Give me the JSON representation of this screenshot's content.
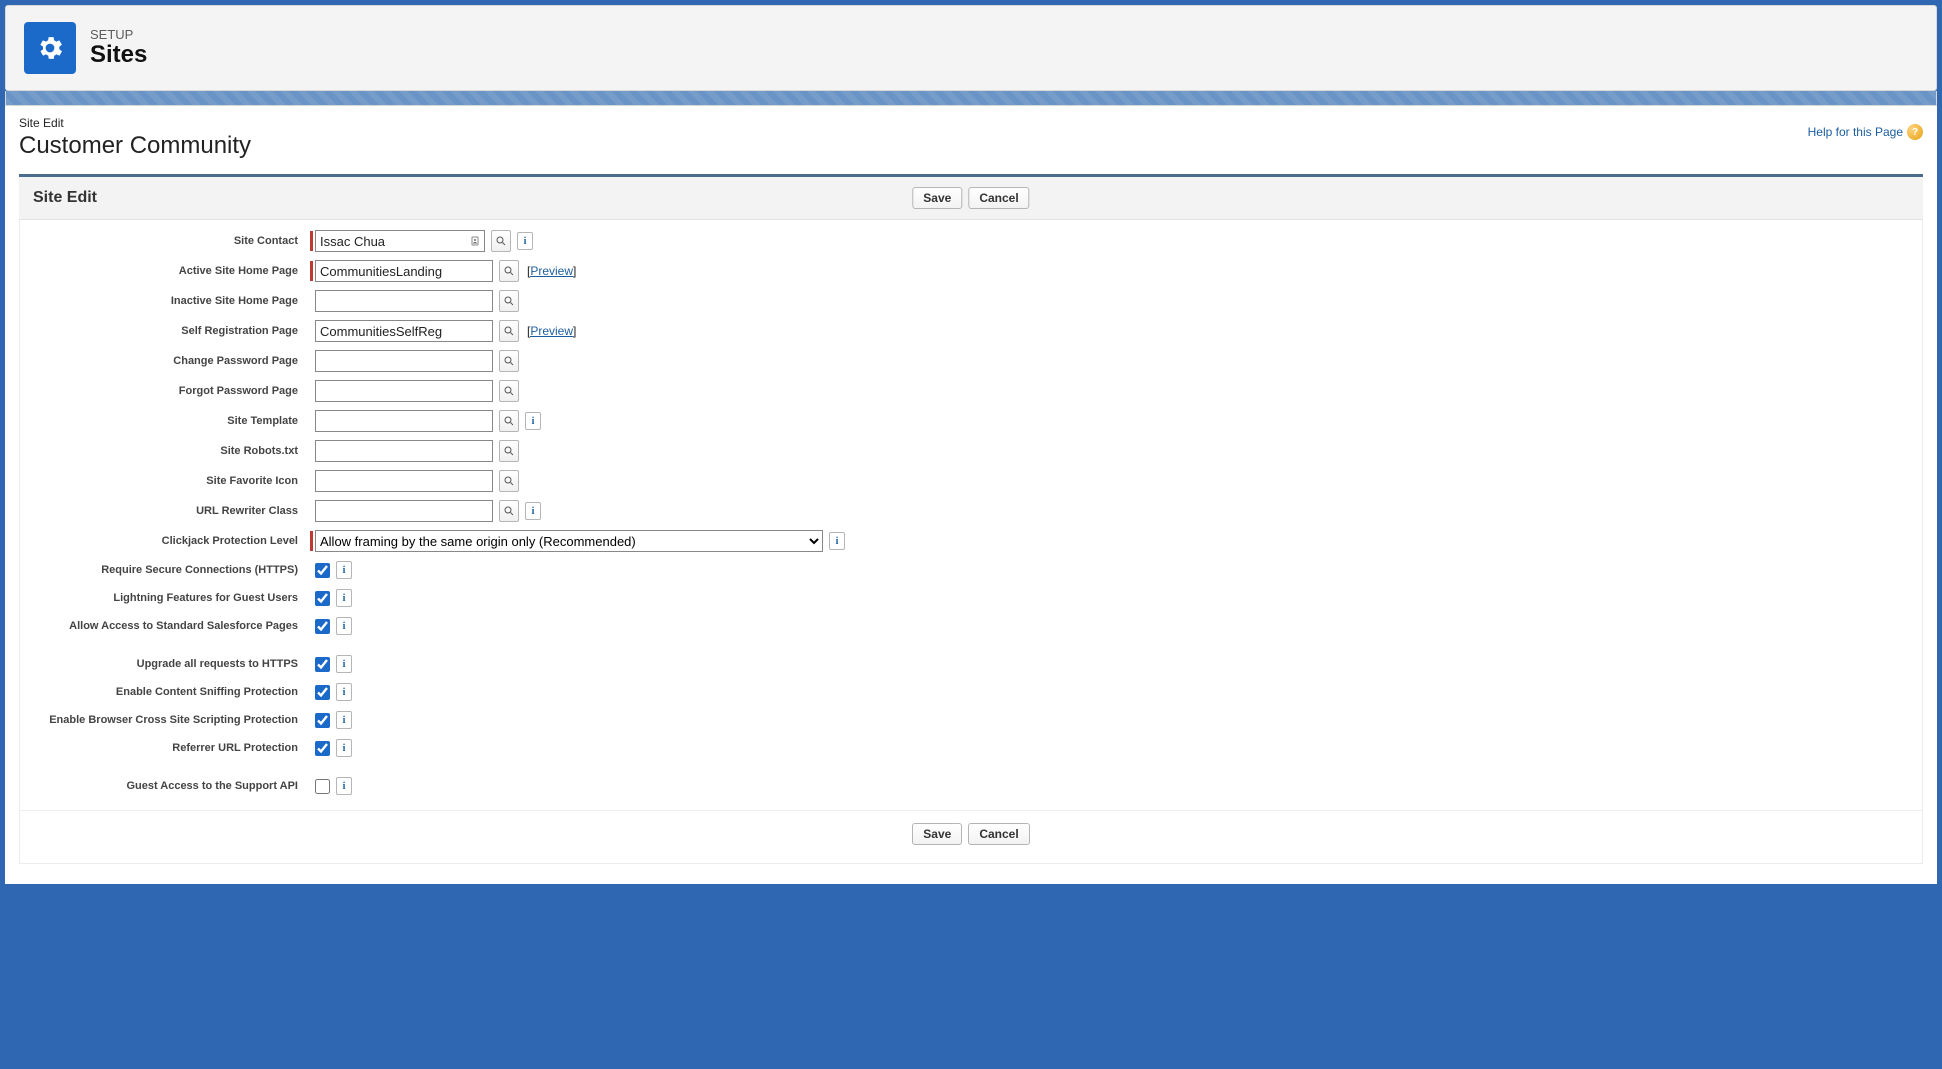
{
  "header": {
    "eyebrow": "SETUP",
    "title": "Sites"
  },
  "page": {
    "crumb": "Site Edit",
    "name": "Customer Community",
    "help_label": "Help for this Page"
  },
  "section": {
    "title": "Site Edit",
    "buttons": {
      "save": "Save",
      "cancel": "Cancel"
    }
  },
  "fields": {
    "site_contact": {
      "label": "Site Contact",
      "value": "Issac Chua",
      "required": true,
      "has_lookup": true,
      "has_info": true
    },
    "active_home_page": {
      "label": "Active Site Home Page",
      "value": "CommunitiesLanding",
      "required": true,
      "has_lookup": true,
      "has_preview": true
    },
    "inactive_home_page": {
      "label": "Inactive Site Home Page",
      "value": "",
      "required": false,
      "has_lookup": true
    },
    "self_registration_page": {
      "label": "Self Registration Page",
      "value": "CommunitiesSelfReg",
      "required": false,
      "has_lookup": true,
      "has_preview": true
    },
    "change_password_page": {
      "label": "Change Password Page",
      "value": "",
      "required": false,
      "has_lookup": true
    },
    "forgot_password_page": {
      "label": "Forgot Password Page",
      "value": "",
      "required": false,
      "has_lookup": true
    },
    "site_template": {
      "label": "Site Template",
      "value": "",
      "required": false,
      "has_lookup": true,
      "has_info": true
    },
    "site_robots": {
      "label": "Site Robots.txt",
      "value": "",
      "required": false,
      "has_lookup": true
    },
    "site_favorite_icon": {
      "label": "Site Favorite Icon",
      "value": "",
      "required": false,
      "has_lookup": true
    },
    "url_rewriter_class": {
      "label": "URL Rewriter Class",
      "value": "",
      "required": false,
      "has_lookup": true,
      "has_info": true
    },
    "clickjack_protection": {
      "label": "Clickjack Protection Level",
      "value": "Allow framing by the same origin only (Recommended)",
      "required": true,
      "has_info": true
    },
    "require_https": {
      "label": "Require Secure Connections (HTTPS)",
      "checked": true,
      "has_info": true
    },
    "lightning_guest": {
      "label": "Lightning Features for Guest Users",
      "checked": true,
      "has_info": true
    },
    "allow_standard_pages": {
      "label": "Allow Access to Standard Salesforce Pages",
      "checked": true,
      "has_info": true
    },
    "upgrade_https": {
      "label": "Upgrade all requests to HTTPS",
      "checked": true,
      "has_info": true
    },
    "content_sniffing": {
      "label": "Enable Content Sniffing Protection",
      "checked": true,
      "has_info": true
    },
    "xss_protection": {
      "label": "Enable Browser Cross Site Scripting Protection",
      "checked": true,
      "has_info": true
    },
    "referrer_protection": {
      "label": "Referrer URL Protection",
      "checked": true,
      "has_info": true
    },
    "guest_support_api": {
      "label": "Guest Access to the Support API",
      "checked": false,
      "has_info": true
    }
  },
  "labels": {
    "preview": "Preview"
  }
}
